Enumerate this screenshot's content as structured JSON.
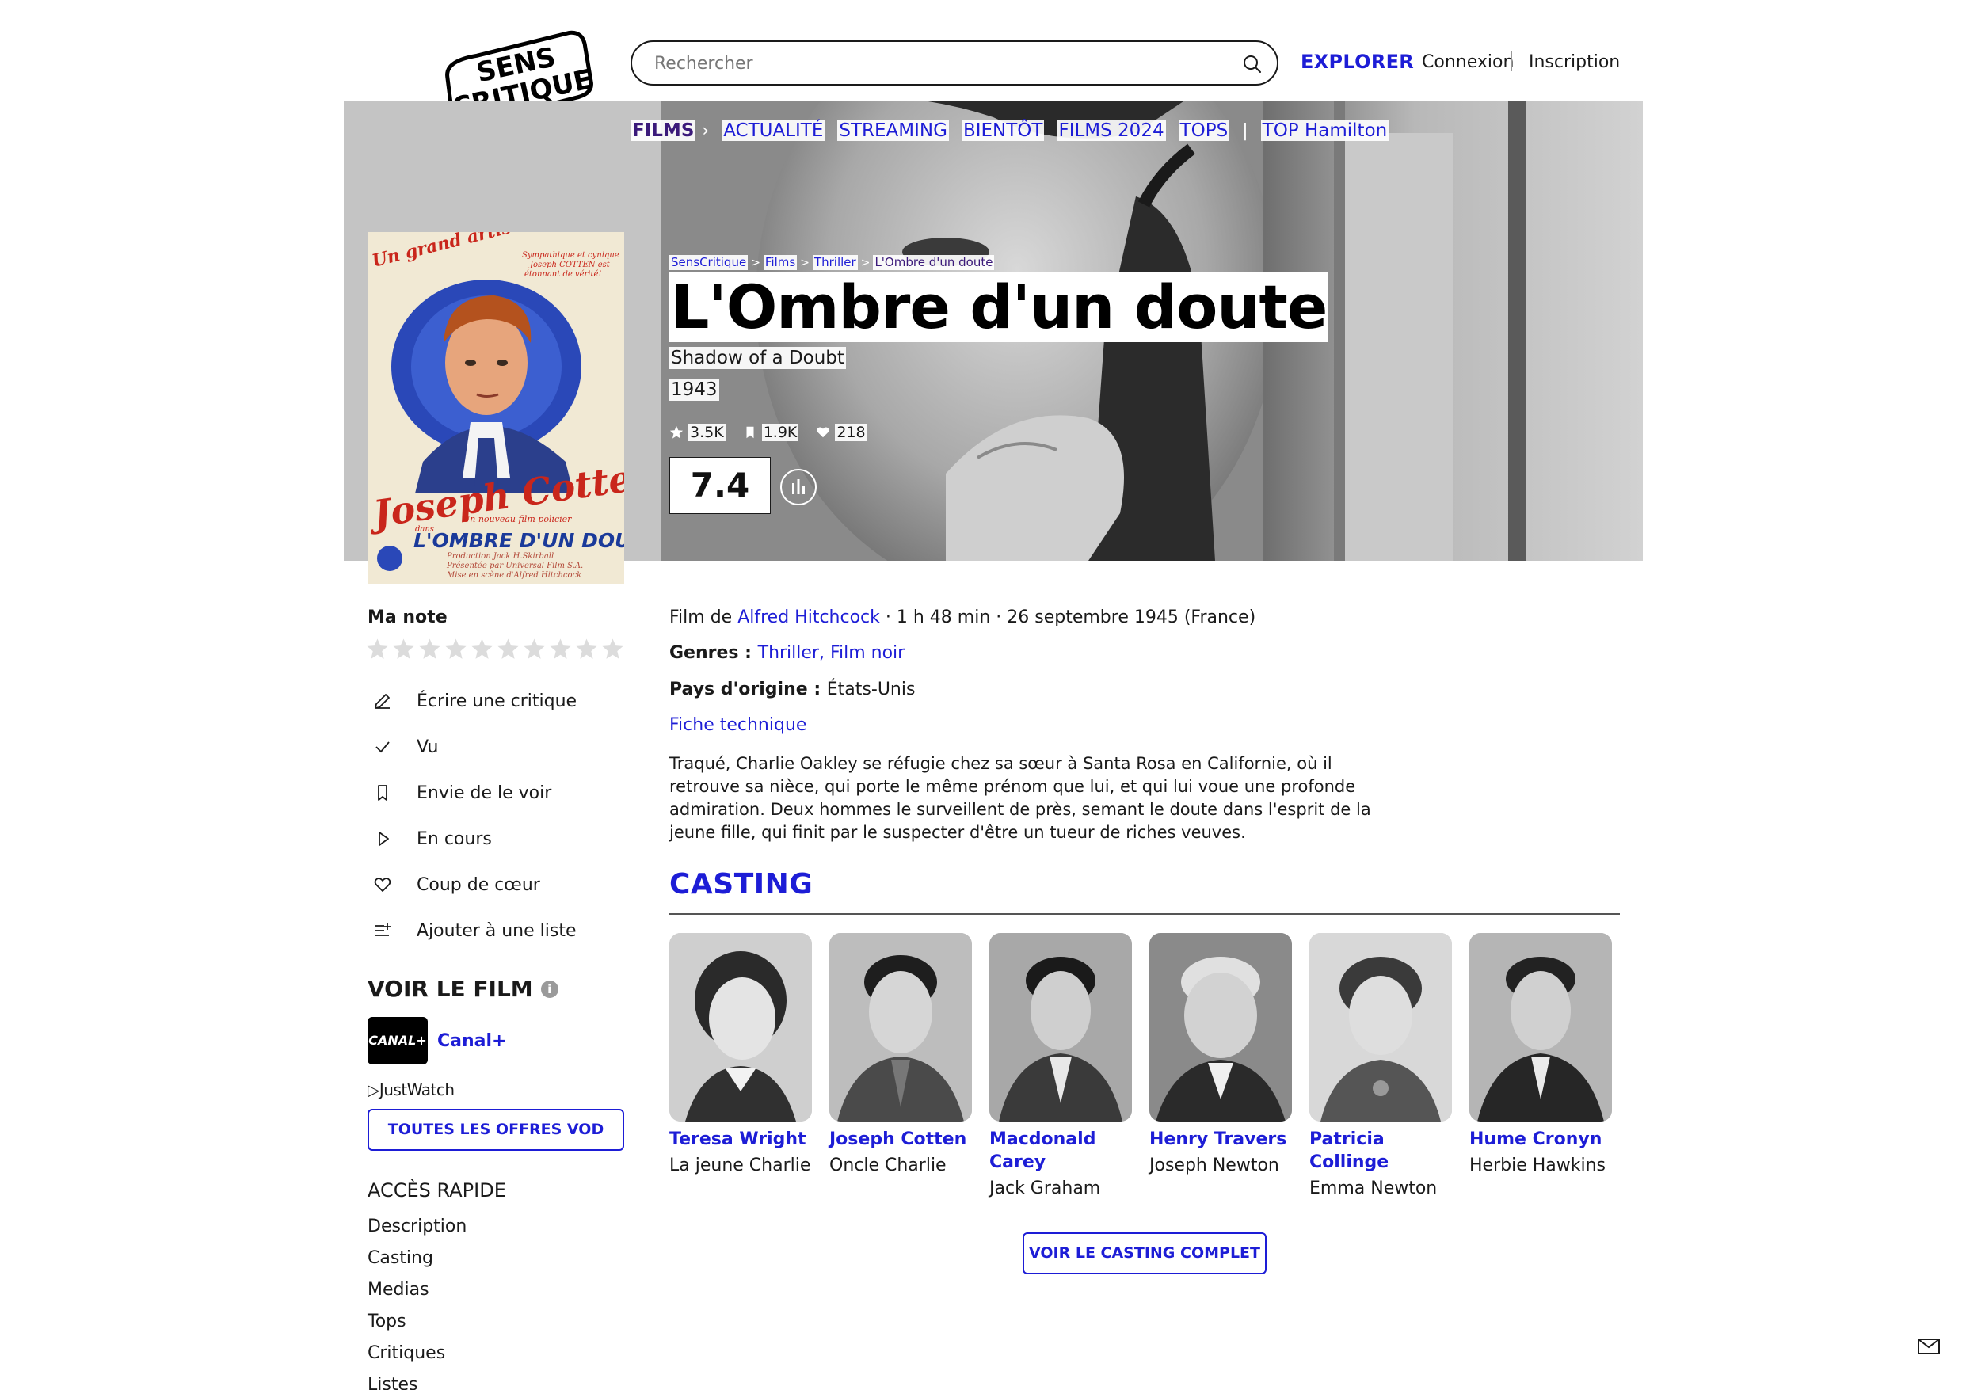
{
  "header": {
    "logo_line1": "SENS",
    "logo_line2": "CRITIQUE",
    "search_placeholder": "Rechercher",
    "explorer": "EXPLORER",
    "connexion": "Connexion",
    "inscription": "Inscription"
  },
  "subnav": {
    "items": [
      "FILMS",
      "ACTUALITÉ",
      "STREAMING",
      "BIENTÔT",
      "FILMS 2024",
      "TOPS",
      "TOP Hamilton"
    ]
  },
  "breadcrumb": [
    "SensCritique",
    "Films",
    "Thriller",
    "L'Ombre d'un doute"
  ],
  "poster": {
    "top_left": "Un grand artiste!",
    "top_right": "Sympathique et cynique Joseph COTTEN est étonnant de vérité!",
    "actor": "Joseph Cotten",
    "dans": "dans",
    "subtitle": "Un nouveau film policier",
    "title": "L'OMBRE D'UN DOUTE",
    "credits1": "Production Jack H.Skirball",
    "credits2": "Présentée par Universal Film S.A.",
    "credits3": "Mise en scène d'Alfred Hitchcock"
  },
  "film": {
    "title": "L'Ombre d'un doute",
    "original_title": "Shadow of a Doubt",
    "year": "1943",
    "stats": {
      "ratings": "3.5K",
      "wishlist": "1.9K",
      "favorites": "218"
    },
    "score": "7.4",
    "film_de_label": "Film de ",
    "director": "Alfred Hitchcock",
    "meta_rest": " · 1 h 48 min · 26 septembre 1945 (France)",
    "genres_label": "Genres : ",
    "genres": "Thriller, Film noir",
    "pays_label": "Pays d'origine : ",
    "pays": "États-Unis",
    "fiche": "Fiche technique",
    "synopsis": "Traqué, Charlie Oakley se réfugie chez sa sœur à Santa Rosa en Californie, où il retrouve sa nièce, qui porte le même prénom que lui, et qui lui voue une profonde admiration. Deux hommes le surveillent de près, semant le doute dans l'esprit de la jeune fille, qui finit par le suspecter d'être un tueur de riches veuves."
  },
  "sidebar": {
    "ma_note": "Ma note",
    "actions": [
      "Écrire une critique",
      "Vu",
      "Envie de le voir",
      "En cours",
      "Coup de cœur",
      "Ajouter à une liste"
    ],
    "voir_le_film": "VOIR LE FILM",
    "provider_logo": "CANAL+",
    "provider_name": "Canal+",
    "justwatch": "JustWatch",
    "offres_button": "TOUTES LES OFFRES VOD",
    "acces_rapide": "ACCÈS RAPIDE",
    "quick_links": [
      "Description",
      "Casting",
      "Medias",
      "Tops",
      "Critiques",
      "Listes"
    ]
  },
  "casting": {
    "title": "CASTING",
    "members": [
      {
        "name": "Teresa Wright",
        "role": "La jeune Charlie"
      },
      {
        "name": "Joseph Cotten",
        "role": "Oncle Charlie"
      },
      {
        "name": "Macdonald Carey",
        "role": "Jack Graham"
      },
      {
        "name": "Henry Travers",
        "role": "Joseph Newton"
      },
      {
        "name": "Patricia Collinge",
        "role": "Emma Newton"
      },
      {
        "name": "Hume Cronyn",
        "role": "Herbie Hawkins"
      }
    ],
    "button": "VOIR LE CASTING COMPLET"
  },
  "colors": {
    "accent": "#1d1dd6",
    "active_nav": "#3b1a7a"
  }
}
